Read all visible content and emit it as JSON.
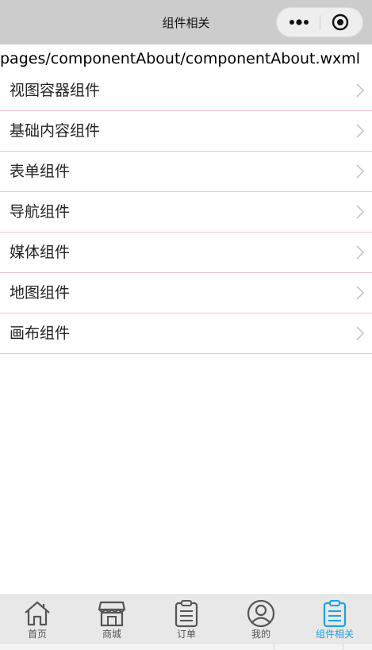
{
  "navbar": {
    "title": "组件相关",
    "more_icon": "more-dots-icon",
    "close_icon": "target-close-icon"
  },
  "path": "pages/componentAbout/componentAbout.wxml",
  "list": {
    "items": [
      {
        "label": "视图容器组件",
        "icon": "chevron-right-icon"
      },
      {
        "label": "基础内容组件",
        "icon": "chevron-right-icon"
      },
      {
        "label": "表单组件",
        "icon": "chevron-right-icon"
      },
      {
        "label": "导航组件",
        "icon": "chevron-right-icon"
      },
      {
        "label": "媒体组件",
        "icon": "chevron-right-icon"
      },
      {
        "label": "地图组件",
        "icon": "chevron-right-icon"
      },
      {
        "label": "画布组件",
        "icon": "chevron-right-icon"
      }
    ],
    "divider_color": "#f2c1d7"
  },
  "tabbar": {
    "tabs": [
      {
        "label": "首页",
        "icon": "home-icon",
        "active": false
      },
      {
        "label": "商城",
        "icon": "store-icon",
        "active": false
      },
      {
        "label": "订单",
        "icon": "clipboard-icon",
        "active": false
      },
      {
        "label": "我的",
        "icon": "user-icon",
        "active": false
      },
      {
        "label": "组件相关",
        "icon": "clipboard-icon",
        "active": true
      }
    ],
    "active_color": "#1f9fe0",
    "inactive_color": "#555555"
  },
  "colors": {
    "navbar_bg": "#cccccc",
    "tabbar_bg": "#e8e8e8"
  }
}
